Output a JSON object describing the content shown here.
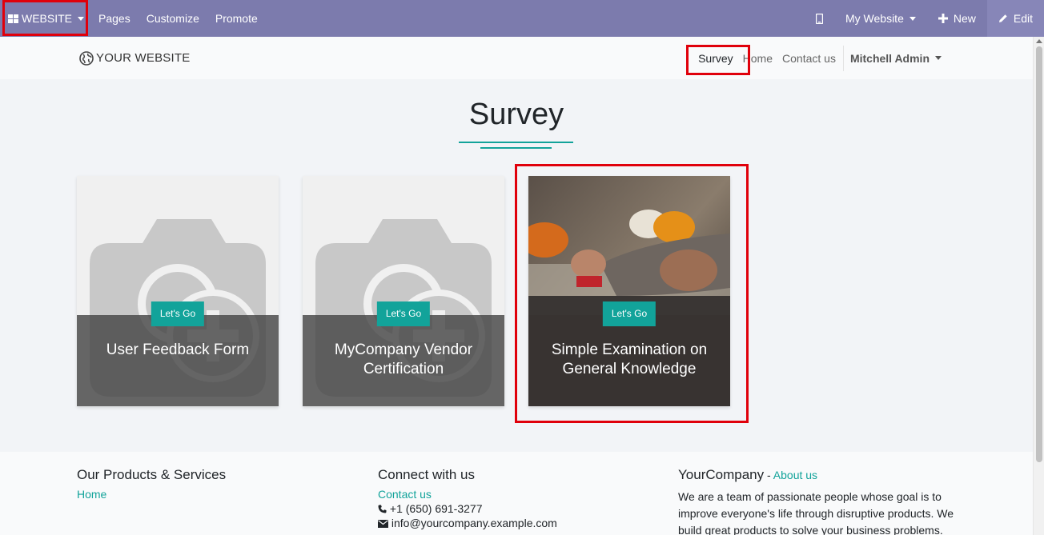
{
  "admin_bar": {
    "website_label": "WEBSITE",
    "pages": "Pages",
    "customize": "Customize",
    "promote": "Promote",
    "my_website": "My Website",
    "new": "New",
    "edit": "Edit"
  },
  "header": {
    "logo_text": "YOUR WEBSITE",
    "nav": [
      "Survey",
      "Home",
      "Contact us"
    ],
    "user": "Mitchell Admin"
  },
  "main": {
    "title": "Survey",
    "cards": [
      {
        "badge": "Let's Go",
        "title": "User Feedback Form"
      },
      {
        "badge": "Let's Go",
        "title": "MyCompany Vendor Certification"
      },
      {
        "badge": "Let's Go",
        "title": "Simple Examination on General Knowledge"
      }
    ]
  },
  "footer": {
    "col1": {
      "heading": "Our Products & Services",
      "link": "Home"
    },
    "col2": {
      "heading": "Connect with us",
      "link": "Contact us",
      "phone": "+1 (650) 691-3277",
      "email": "info@yourcompany.example.com"
    },
    "col3": {
      "heading": "YourCompany",
      "sep": " - ",
      "link": "About us",
      "text": "We are a team of passionate people whose goal is to improve everyone's life through disruptive products. We build great products to solve your business problems."
    }
  },
  "colors": {
    "admin_bar": "#7c7bad",
    "accent": "#12a39a",
    "highlight": "#e0000b"
  }
}
